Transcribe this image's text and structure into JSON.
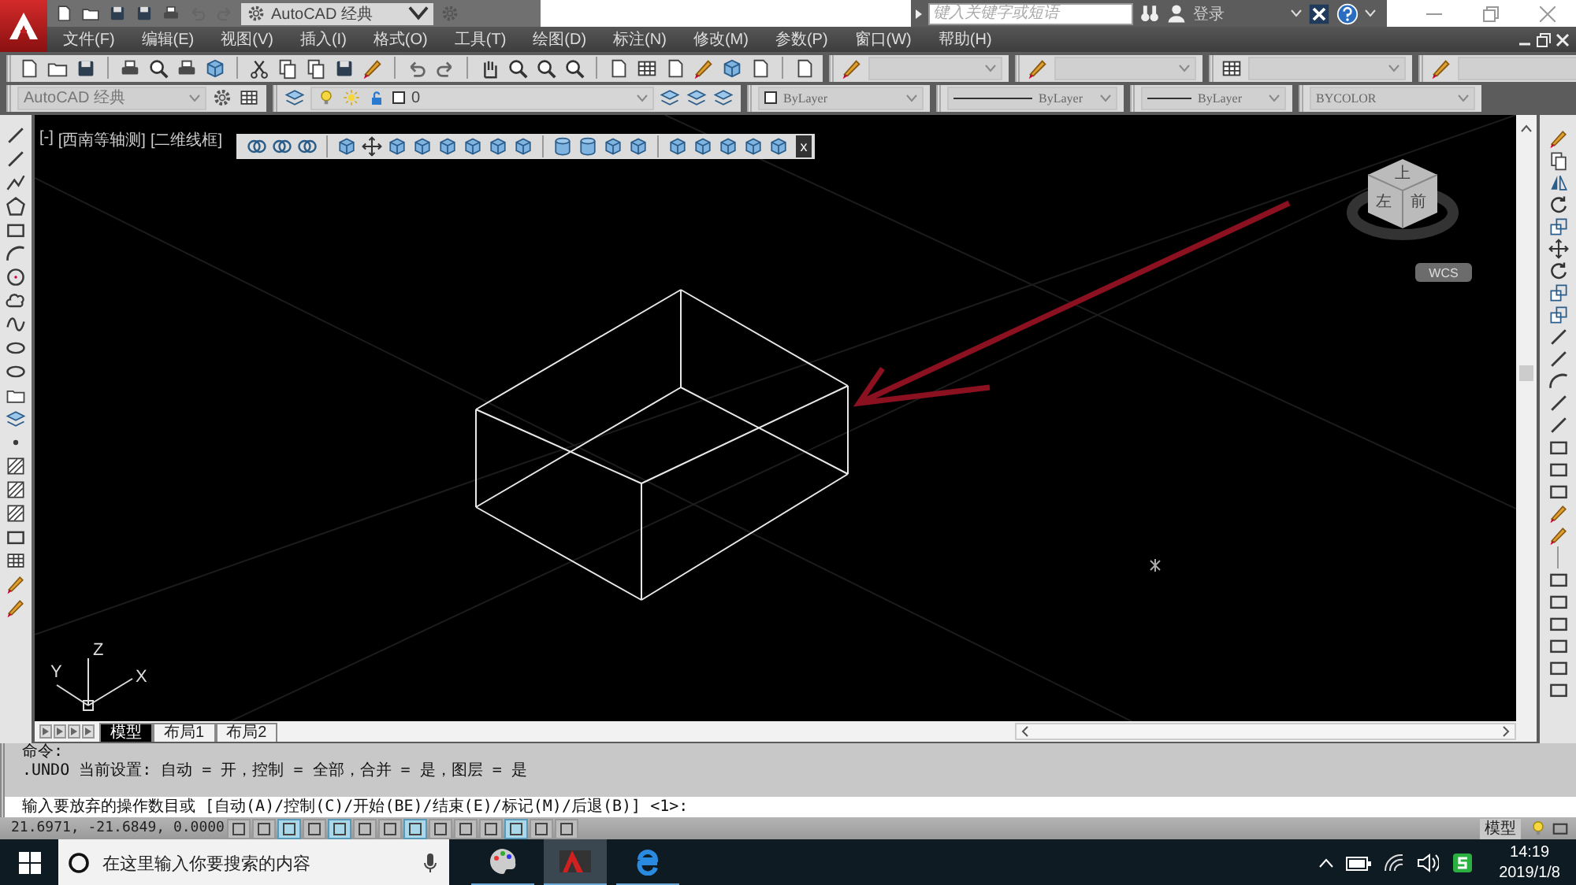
{
  "title_bar": {
    "workspace": "AutoCAD 经典",
    "search": {
      "placeholder": "键入关键字或短语"
    },
    "sign_in": "登录"
  },
  "menu_bar": {
    "items": [
      "文件(F)",
      "编辑(E)",
      "视图(V)",
      "插入(I)",
      "格式(O)",
      "工具(T)",
      "绘图(D)",
      "标注(N)",
      "修改(M)",
      "参数(P)",
      "窗口(W)",
      "帮助(H)"
    ]
  },
  "properties_toolbar": {
    "workspace": "AutoCAD 经典",
    "layer": "0",
    "color_setting": "ByLayer",
    "linetype": "ByLayer",
    "lineweight": "ByLayer",
    "plot_style": "BYCOLOR"
  },
  "viewport": {
    "controls": "[-]",
    "view": "[西南等轴测]",
    "visual_style": "[二维线框]"
  },
  "floating_toolbar": {
    "close": "x"
  },
  "viewcube": {
    "faces": [
      "上",
      "左",
      "前"
    ],
    "ucs_menu": "WCS"
  },
  "ucs_icon": {
    "labels": [
      "Y",
      "Z",
      "X"
    ]
  },
  "layout_tabs": [
    {
      "label": "模型",
      "selected": true
    },
    {
      "label": "布局1",
      "selected": false
    },
    {
      "label": "布局2",
      "selected": false
    }
  ],
  "command_line": {
    "history": [
      "命令:",
      ".UNDO 当前设置: 自动 = 开，控制 = 全部，合并 = 是，图层 = 是"
    ],
    "prompt": "输入要放弃的操作数目或 [自动(A)/控制(C)/开始(BE)/结束(E)/标记(M)/后退(B)] <1>:"
  },
  "status_bar": {
    "coordinates": "21.6971, -21.6849, 0.0000",
    "model": "模型",
    "toggles": [
      {
        "on": false
      },
      {
        "on": false
      },
      {
        "on": true
      },
      {
        "on": false
      },
      {
        "on": true
      },
      {
        "on": false
      },
      {
        "on": false
      },
      {
        "on": true
      },
      {
        "on": false
      },
      {
        "on": false
      },
      {
        "on": false
      },
      {
        "on": true
      },
      {
        "on": false
      },
      {
        "on": false
      }
    ]
  },
  "taskbar": {
    "search": {
      "placeholder": "在这里输入你要搜索的内容"
    },
    "apps": [
      {
        "selected": false
      },
      {
        "selected": true
      },
      {
        "selected": false
      }
    ],
    "time": "14:19",
    "date": "2019/1/8"
  }
}
